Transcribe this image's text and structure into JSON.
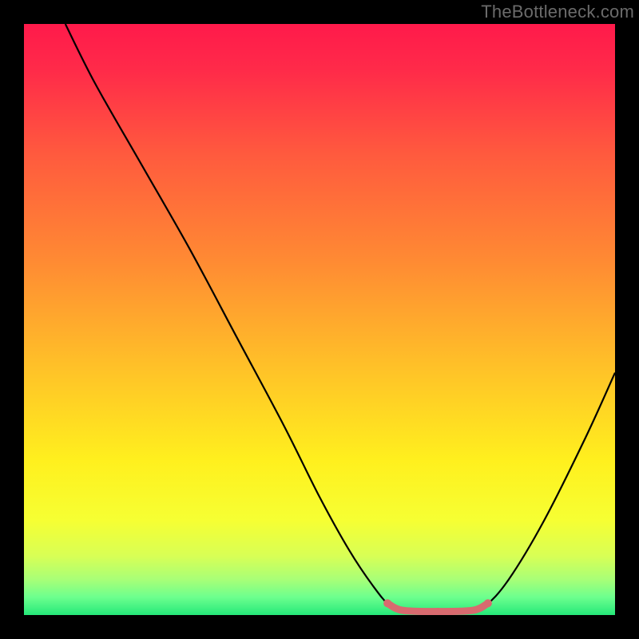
{
  "watermark": "TheBottleneck.com",
  "chart_data": {
    "type": "line",
    "title": "",
    "xlabel": "",
    "ylabel": "",
    "xlim": [
      0,
      100
    ],
    "ylim": [
      0,
      100
    ],
    "grid": false,
    "legend": false,
    "gradient_stops": [
      {
        "offset": 0,
        "color": "#ff1a4b"
      },
      {
        "offset": 0.08,
        "color": "#ff2b49"
      },
      {
        "offset": 0.22,
        "color": "#ff5a3e"
      },
      {
        "offset": 0.4,
        "color": "#ff8a33"
      },
      {
        "offset": 0.58,
        "color": "#ffc128"
      },
      {
        "offset": 0.74,
        "color": "#fff01e"
      },
      {
        "offset": 0.84,
        "color": "#f6ff33"
      },
      {
        "offset": 0.9,
        "color": "#d8ff55"
      },
      {
        "offset": 0.94,
        "color": "#a8ff77"
      },
      {
        "offset": 0.97,
        "color": "#6cff8e"
      },
      {
        "offset": 1.0,
        "color": "#25e879"
      }
    ],
    "series": [
      {
        "name": "bottleneck-curve",
        "color": "#000000",
        "width": 2.2,
        "points": [
          {
            "x": 7.0,
            "y": 100.0
          },
          {
            "x": 12.0,
            "y": 90.0
          },
          {
            "x": 20.0,
            "y": 76.0
          },
          {
            "x": 28.0,
            "y": 62.0
          },
          {
            "x": 36.0,
            "y": 47.0
          },
          {
            "x": 44.0,
            "y": 32.0
          },
          {
            "x": 50.0,
            "y": 20.0
          },
          {
            "x": 55.0,
            "y": 11.0
          },
          {
            "x": 59.0,
            "y": 5.0
          },
          {
            "x": 62.0,
            "y": 1.5
          },
          {
            "x": 65.0,
            "y": 0.4
          },
          {
            "x": 70.0,
            "y": 0.2
          },
          {
            "x": 75.0,
            "y": 0.4
          },
          {
            "x": 78.0,
            "y": 1.5
          },
          {
            "x": 82.0,
            "y": 6.0
          },
          {
            "x": 88.0,
            "y": 16.0
          },
          {
            "x": 95.0,
            "y": 30.0
          },
          {
            "x": 100.0,
            "y": 41.0
          }
        ]
      },
      {
        "name": "optimal-band",
        "color": "#d86a6f",
        "width": 9,
        "cap": "round",
        "points": [
          {
            "x": 61.5,
            "y": 2.0
          },
          {
            "x": 64.0,
            "y": 0.8
          },
          {
            "x": 70.0,
            "y": 0.6
          },
          {
            "x": 76.0,
            "y": 0.8
          },
          {
            "x": 78.5,
            "y": 2.0
          }
        ],
        "endpoints": [
          {
            "x": 61.5,
            "y": 2.0
          },
          {
            "x": 78.5,
            "y": 2.0
          }
        ]
      }
    ]
  }
}
